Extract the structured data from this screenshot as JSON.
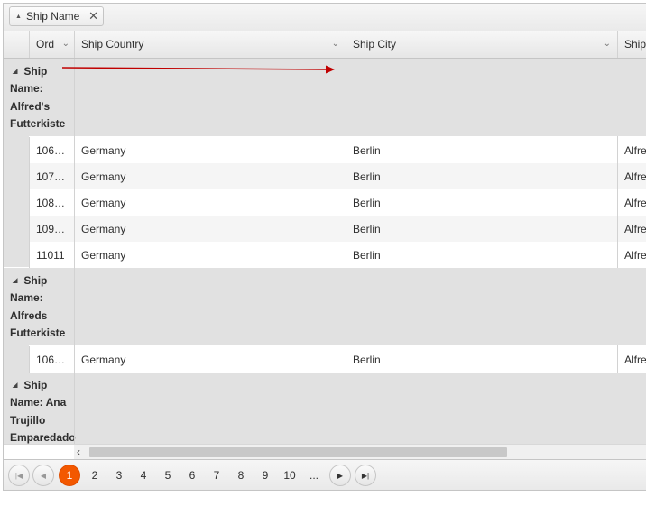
{
  "group_panel": {
    "chip_label": "Ship Name"
  },
  "columns": [
    {
      "label": "Ord"
    },
    {
      "label": "Ship Country"
    },
    {
      "label": "Ship City"
    },
    {
      "label": "Ship"
    }
  ],
  "groups": [
    {
      "label_prefix": "Ship Name:",
      "value": "Alfred's Futterkiste",
      "label_lines": [
        "Ship",
        "Name:",
        "Alfred's",
        "Futterkiste"
      ],
      "rows": [
        {
          "order": "106…",
          "country": "Germany",
          "city": "Berlin",
          "name": "Alfrec"
        },
        {
          "order": "107…",
          "country": "Germany",
          "city": "Berlin",
          "name": "Alfrec"
        },
        {
          "order": "108…",
          "country": "Germany",
          "city": "Berlin",
          "name": "Alfrec"
        },
        {
          "order": "109…",
          "country": "Germany",
          "city": "Berlin",
          "name": "Alfrec"
        },
        {
          "order": "11011",
          "country": "Germany",
          "city": "Berlin",
          "name": "Alfrec"
        }
      ]
    },
    {
      "label_prefix": "Ship Name:",
      "value": "Alfreds Futterkiste",
      "label_lines": [
        "Ship",
        "Name:",
        "Alfreds",
        "Futterkiste"
      ],
      "rows": [
        {
          "order": "106…",
          "country": "Germany",
          "city": "Berlin",
          "name": "Alfrec"
        }
      ]
    },
    {
      "label_prefix": "Ship Name:",
      "value": "Ana Trujillo Emparedados",
      "label_lines": [
        "Ship",
        "Name: Ana",
        "Trujillo",
        "Emparedado"
      ],
      "rows": []
    }
  ],
  "pager": {
    "pages": [
      "1",
      "2",
      "3",
      "4",
      "5",
      "6",
      "7",
      "8",
      "9",
      "10",
      "..."
    ],
    "current": "1"
  },
  "colors": {
    "accent": "#f35800",
    "arrow": "#c00000"
  }
}
